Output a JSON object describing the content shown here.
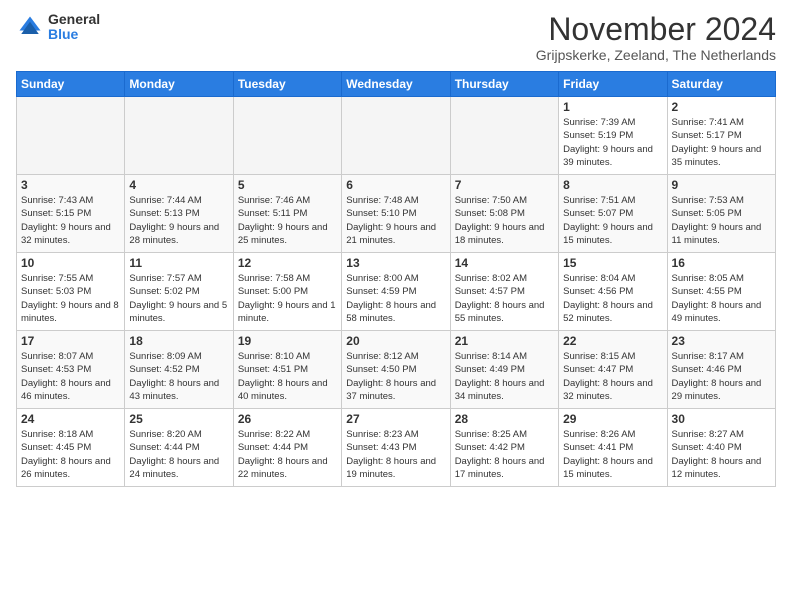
{
  "logo": {
    "general": "General",
    "blue": "Blue"
  },
  "header": {
    "month": "November 2024",
    "location": "Grijpskerke, Zeeland, The Netherlands"
  },
  "weekdays": [
    "Sunday",
    "Monday",
    "Tuesday",
    "Wednesday",
    "Thursday",
    "Friday",
    "Saturday"
  ],
  "weeks": [
    [
      {
        "day": "",
        "info": ""
      },
      {
        "day": "",
        "info": ""
      },
      {
        "day": "",
        "info": ""
      },
      {
        "day": "",
        "info": ""
      },
      {
        "day": "",
        "info": ""
      },
      {
        "day": "1",
        "info": "Sunrise: 7:39 AM\nSunset: 5:19 PM\nDaylight: 9 hours and 39 minutes."
      },
      {
        "day": "2",
        "info": "Sunrise: 7:41 AM\nSunset: 5:17 PM\nDaylight: 9 hours and 35 minutes."
      }
    ],
    [
      {
        "day": "3",
        "info": "Sunrise: 7:43 AM\nSunset: 5:15 PM\nDaylight: 9 hours and 32 minutes."
      },
      {
        "day": "4",
        "info": "Sunrise: 7:44 AM\nSunset: 5:13 PM\nDaylight: 9 hours and 28 minutes."
      },
      {
        "day": "5",
        "info": "Sunrise: 7:46 AM\nSunset: 5:11 PM\nDaylight: 9 hours and 25 minutes."
      },
      {
        "day": "6",
        "info": "Sunrise: 7:48 AM\nSunset: 5:10 PM\nDaylight: 9 hours and 21 minutes."
      },
      {
        "day": "7",
        "info": "Sunrise: 7:50 AM\nSunset: 5:08 PM\nDaylight: 9 hours and 18 minutes."
      },
      {
        "day": "8",
        "info": "Sunrise: 7:51 AM\nSunset: 5:07 PM\nDaylight: 9 hours and 15 minutes."
      },
      {
        "day": "9",
        "info": "Sunrise: 7:53 AM\nSunset: 5:05 PM\nDaylight: 9 hours and 11 minutes."
      }
    ],
    [
      {
        "day": "10",
        "info": "Sunrise: 7:55 AM\nSunset: 5:03 PM\nDaylight: 9 hours and 8 minutes."
      },
      {
        "day": "11",
        "info": "Sunrise: 7:57 AM\nSunset: 5:02 PM\nDaylight: 9 hours and 5 minutes."
      },
      {
        "day": "12",
        "info": "Sunrise: 7:58 AM\nSunset: 5:00 PM\nDaylight: 9 hours and 1 minute."
      },
      {
        "day": "13",
        "info": "Sunrise: 8:00 AM\nSunset: 4:59 PM\nDaylight: 8 hours and 58 minutes."
      },
      {
        "day": "14",
        "info": "Sunrise: 8:02 AM\nSunset: 4:57 PM\nDaylight: 8 hours and 55 minutes."
      },
      {
        "day": "15",
        "info": "Sunrise: 8:04 AM\nSunset: 4:56 PM\nDaylight: 8 hours and 52 minutes."
      },
      {
        "day": "16",
        "info": "Sunrise: 8:05 AM\nSunset: 4:55 PM\nDaylight: 8 hours and 49 minutes."
      }
    ],
    [
      {
        "day": "17",
        "info": "Sunrise: 8:07 AM\nSunset: 4:53 PM\nDaylight: 8 hours and 46 minutes."
      },
      {
        "day": "18",
        "info": "Sunrise: 8:09 AM\nSunset: 4:52 PM\nDaylight: 8 hours and 43 minutes."
      },
      {
        "day": "19",
        "info": "Sunrise: 8:10 AM\nSunset: 4:51 PM\nDaylight: 8 hours and 40 minutes."
      },
      {
        "day": "20",
        "info": "Sunrise: 8:12 AM\nSunset: 4:50 PM\nDaylight: 8 hours and 37 minutes."
      },
      {
        "day": "21",
        "info": "Sunrise: 8:14 AM\nSunset: 4:49 PM\nDaylight: 8 hours and 34 minutes."
      },
      {
        "day": "22",
        "info": "Sunrise: 8:15 AM\nSunset: 4:47 PM\nDaylight: 8 hours and 32 minutes."
      },
      {
        "day": "23",
        "info": "Sunrise: 8:17 AM\nSunset: 4:46 PM\nDaylight: 8 hours and 29 minutes."
      }
    ],
    [
      {
        "day": "24",
        "info": "Sunrise: 8:18 AM\nSunset: 4:45 PM\nDaylight: 8 hours and 26 minutes."
      },
      {
        "day": "25",
        "info": "Sunrise: 8:20 AM\nSunset: 4:44 PM\nDaylight: 8 hours and 24 minutes."
      },
      {
        "day": "26",
        "info": "Sunrise: 8:22 AM\nSunset: 4:44 PM\nDaylight: 8 hours and 22 minutes."
      },
      {
        "day": "27",
        "info": "Sunrise: 8:23 AM\nSunset: 4:43 PM\nDaylight: 8 hours and 19 minutes."
      },
      {
        "day": "28",
        "info": "Sunrise: 8:25 AM\nSunset: 4:42 PM\nDaylight: 8 hours and 17 minutes."
      },
      {
        "day": "29",
        "info": "Sunrise: 8:26 AM\nSunset: 4:41 PM\nDaylight: 8 hours and 15 minutes."
      },
      {
        "day": "30",
        "info": "Sunrise: 8:27 AM\nSunset: 4:40 PM\nDaylight: 8 hours and 12 minutes."
      }
    ]
  ]
}
